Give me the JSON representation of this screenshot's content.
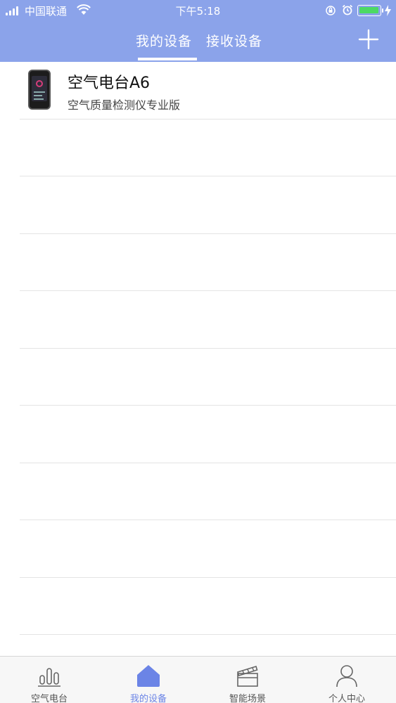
{
  "status_bar": {
    "carrier": "中国联通",
    "time": "下午5:18",
    "battery_color": "#4cd964"
  },
  "header": {
    "background": "#8ba3ea",
    "tabs": [
      {
        "label": "我的设备",
        "active": true
      },
      {
        "label": "接收设备",
        "active": false
      }
    ],
    "add_icon": "plus-icon"
  },
  "devices": [
    {
      "name": "空气电台A6",
      "description": "空气质量检测仪专业版",
      "icon": "device-thumbnail"
    }
  ],
  "tabbar": {
    "active_color": "#6b84e6",
    "items": [
      {
        "label": "空气电台",
        "icon": "bar-chart-icon",
        "active": false
      },
      {
        "label": "我的设备",
        "icon": "home-icon",
        "active": true
      },
      {
        "label": "智能场景",
        "icon": "clapperboard-icon",
        "active": false
      },
      {
        "label": "个人中心",
        "icon": "person-icon",
        "active": false
      }
    ]
  }
}
